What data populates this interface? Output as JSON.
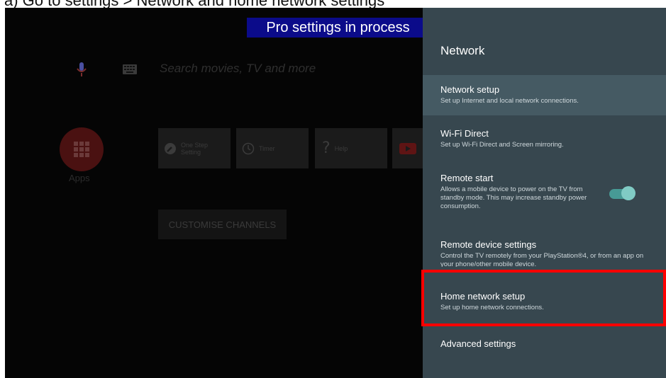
{
  "caption": "a)   Go to settings > Network and home network settings",
  "banner": "Pro settings in process",
  "home": {
    "search_placeholder": "Search movies, TV and more",
    "apps_label": "Apps",
    "tiles": [
      {
        "label": "One Step Setting",
        "icon": "wrench-icon"
      },
      {
        "label": "Timer",
        "icon": "clock-icon"
      },
      {
        "label": "Help",
        "icon": "question-icon"
      },
      {
        "label": "",
        "icon": "youtube-icon"
      }
    ],
    "customise_button": "CUSTOMISE CHANNELS"
  },
  "panel": {
    "title": "Network",
    "items": [
      {
        "title": "Network setup",
        "subtitle": "Set up Internet and local network connections."
      },
      {
        "title": "Wi-Fi Direct",
        "subtitle": "Set up Wi-Fi Direct and Screen mirroring."
      },
      {
        "title": "Remote start",
        "subtitle": "Allows a mobile device to power on the TV from standby mode. This may increase standby power consumption."
      },
      {
        "title": "Remote device settings",
        "subtitle": "Control the TV remotely from your PlayStation®4, or from an app on your phone/other mobile device."
      },
      {
        "title": "Home network setup",
        "subtitle": "Set up home network connections."
      },
      {
        "title": "Advanced settings",
        "subtitle": ""
      }
    ],
    "remote_start_toggle": "on"
  },
  "colors": {
    "panel_bg": "#37474f",
    "selected_bg": "#455a63",
    "highlight": "#ff0000",
    "toggle": "#80cbc4",
    "banner_bg": "#0b0b8a"
  }
}
